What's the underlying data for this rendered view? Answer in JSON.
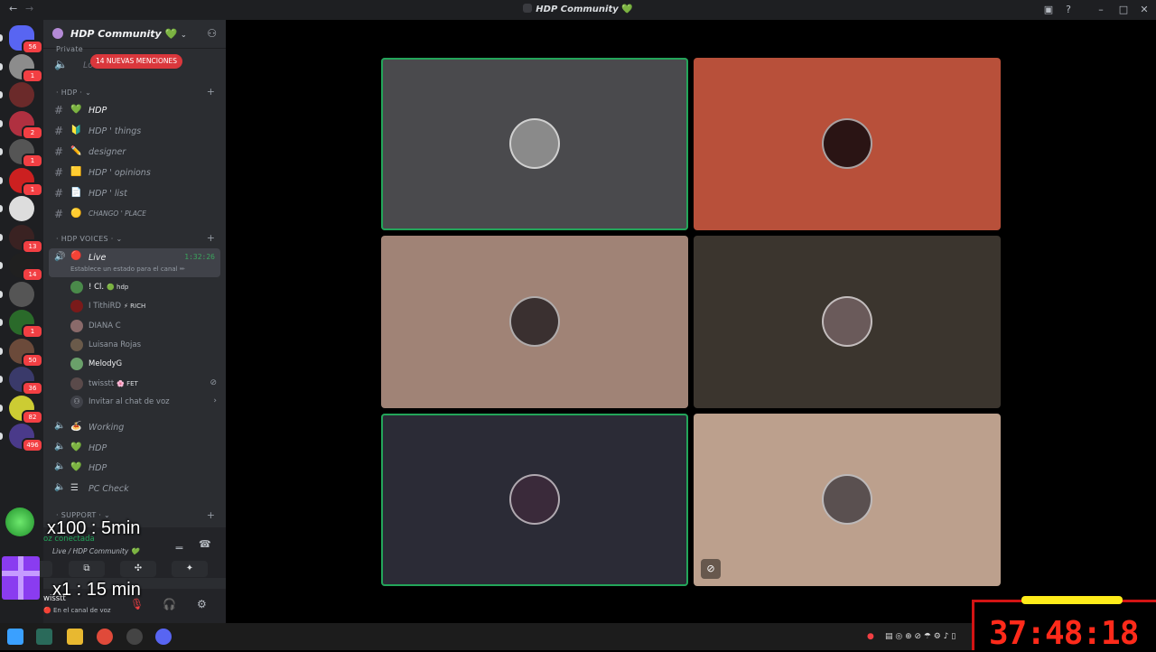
{
  "window": {
    "title": "HDP Community",
    "back": "←",
    "forward": "→",
    "title_heart": "💚"
  },
  "rail": {
    "servers": [
      {
        "badge": "56",
        "color": "#5865f2"
      },
      {
        "badge": "1",
        "color": "#8c8c8c"
      },
      {
        "badge": "",
        "color": "#6b2a2a"
      },
      {
        "badge": "2",
        "color": "#b03040"
      },
      {
        "badge": "1",
        "color": "#555555"
      },
      {
        "badge": "1",
        "color": "#cc2020"
      },
      {
        "badge": "",
        "color": "#dddddd"
      },
      {
        "badge": "13",
        "color": "#3a2222"
      },
      {
        "badge": "14",
        "color": "#202020"
      },
      {
        "badge": "",
        "color": "#555555"
      },
      {
        "badge": "1",
        "color": "#2a6a2a"
      },
      {
        "badge": "50",
        "color": "#6b4a3a"
      },
      {
        "badge": "36",
        "color": "#3a3a6a"
      },
      {
        "badge": "82",
        "color": "#cccc33"
      },
      {
        "badge": "496",
        "color": "#4a3a8a"
      }
    ]
  },
  "sidebar": {
    "server_name": "HDP Community",
    "server_heart": "💚",
    "mentions_pill": "14 NUEVAS MENCIONES",
    "private_label": "Private",
    "private_channel": "Lo",
    "categories": {
      "hdp": "HDP",
      "voices": "HDP VOICES",
      "support": "SUPPORT"
    },
    "text_channels": [
      {
        "emoji": "💚",
        "name": "HDP",
        "active": true
      },
      {
        "emoji": "🔰",
        "name": "HDP ' things",
        "active": false
      },
      {
        "emoji": "✏️",
        "name": "designer",
        "active": false
      },
      {
        "emoji": "🟨",
        "name": "HDP ' opinions",
        "active": false
      },
      {
        "emoji": "📄",
        "name": "HDP ' list",
        "active": false
      },
      {
        "emoji": "🟡",
        "name": "CHANGO ' PLACE",
        "active": false
      }
    ],
    "live_channel": {
      "emoji": "🔴",
      "name": "Live",
      "time": "1:32:26",
      "status": "Establece un estado para el canal ✏"
    },
    "members": [
      {
        "name": "! Cl.",
        "tag": "🟢 hdp",
        "color": "#4a8a4a",
        "muted": false
      },
      {
        "name": "I TithiRD",
        "tag": "⚡ RICH",
        "color": "#7a1a1a",
        "muted": false
      },
      {
        "name": "DIANA C",
        "tag": "",
        "color": "#8a6a6a",
        "muted": false
      },
      {
        "name": "Luisana Rojas",
        "tag": "",
        "color": "#6a5a4a",
        "muted": false
      },
      {
        "name": "MelodyG",
        "tag": "",
        "color": "#6aa06a",
        "muted": false
      },
      {
        "name": "twisstt",
        "tag": "🌸 FET",
        "color": "#5a4a4a",
        "muted": true
      }
    ],
    "invite_label": "Invitar al chat de voz",
    "voice_channels": [
      {
        "emoji": "🍝",
        "name": "Working"
      },
      {
        "emoji": "💚",
        "name": "HDP"
      },
      {
        "emoji": "💚",
        "name": "HDP"
      },
      {
        "emoji": "☰",
        "name": "PC Check"
      }
    ],
    "voice_panel": {
      "status": "oz conectada",
      "location": "Live / HDP Community 💚"
    },
    "user": {
      "name": "wisstt",
      "status": "🔴 En el canal de voz"
    }
  },
  "overlay": {
    "line1": "x100 : 5min",
    "line2": "x1 : 15 min",
    "timer": "37:48:18"
  },
  "stage": {
    "tiles": [
      {
        "color": "#4a4a4d",
        "avatar": "#8a8a8a",
        "speaking": true,
        "muted": false
      },
      {
        "color": "#b8503a",
        "avatar": "#2a1414",
        "speaking": false,
        "muted": false
      },
      {
        "color": "#a08376",
        "avatar": "#3a3030",
        "speaking": false,
        "muted": false
      },
      {
        "color": "#3b352e",
        "avatar": "#6a5a5a",
        "speaking": false,
        "muted": false
      },
      {
        "color": "#2b2b36",
        "avatar": "#3a2a3a",
        "speaking": true,
        "muted": false
      },
      {
        "color": "#bca08d",
        "avatar": "#5a5050",
        "speaking": false,
        "muted": true
      }
    ]
  },
  "taskbar": {
    "apps": [
      {
        "name": "windows-start",
        "color": "#3aa0ff"
      },
      {
        "name": "terminal",
        "color": "#2a6a5a"
      },
      {
        "name": "file-explorer",
        "color": "#e8b830"
      },
      {
        "name": "chrome",
        "color": "#e04a3a"
      },
      {
        "name": "obs",
        "color": "#444444"
      },
      {
        "name": "discord",
        "color": "#5865f2"
      }
    ]
  }
}
